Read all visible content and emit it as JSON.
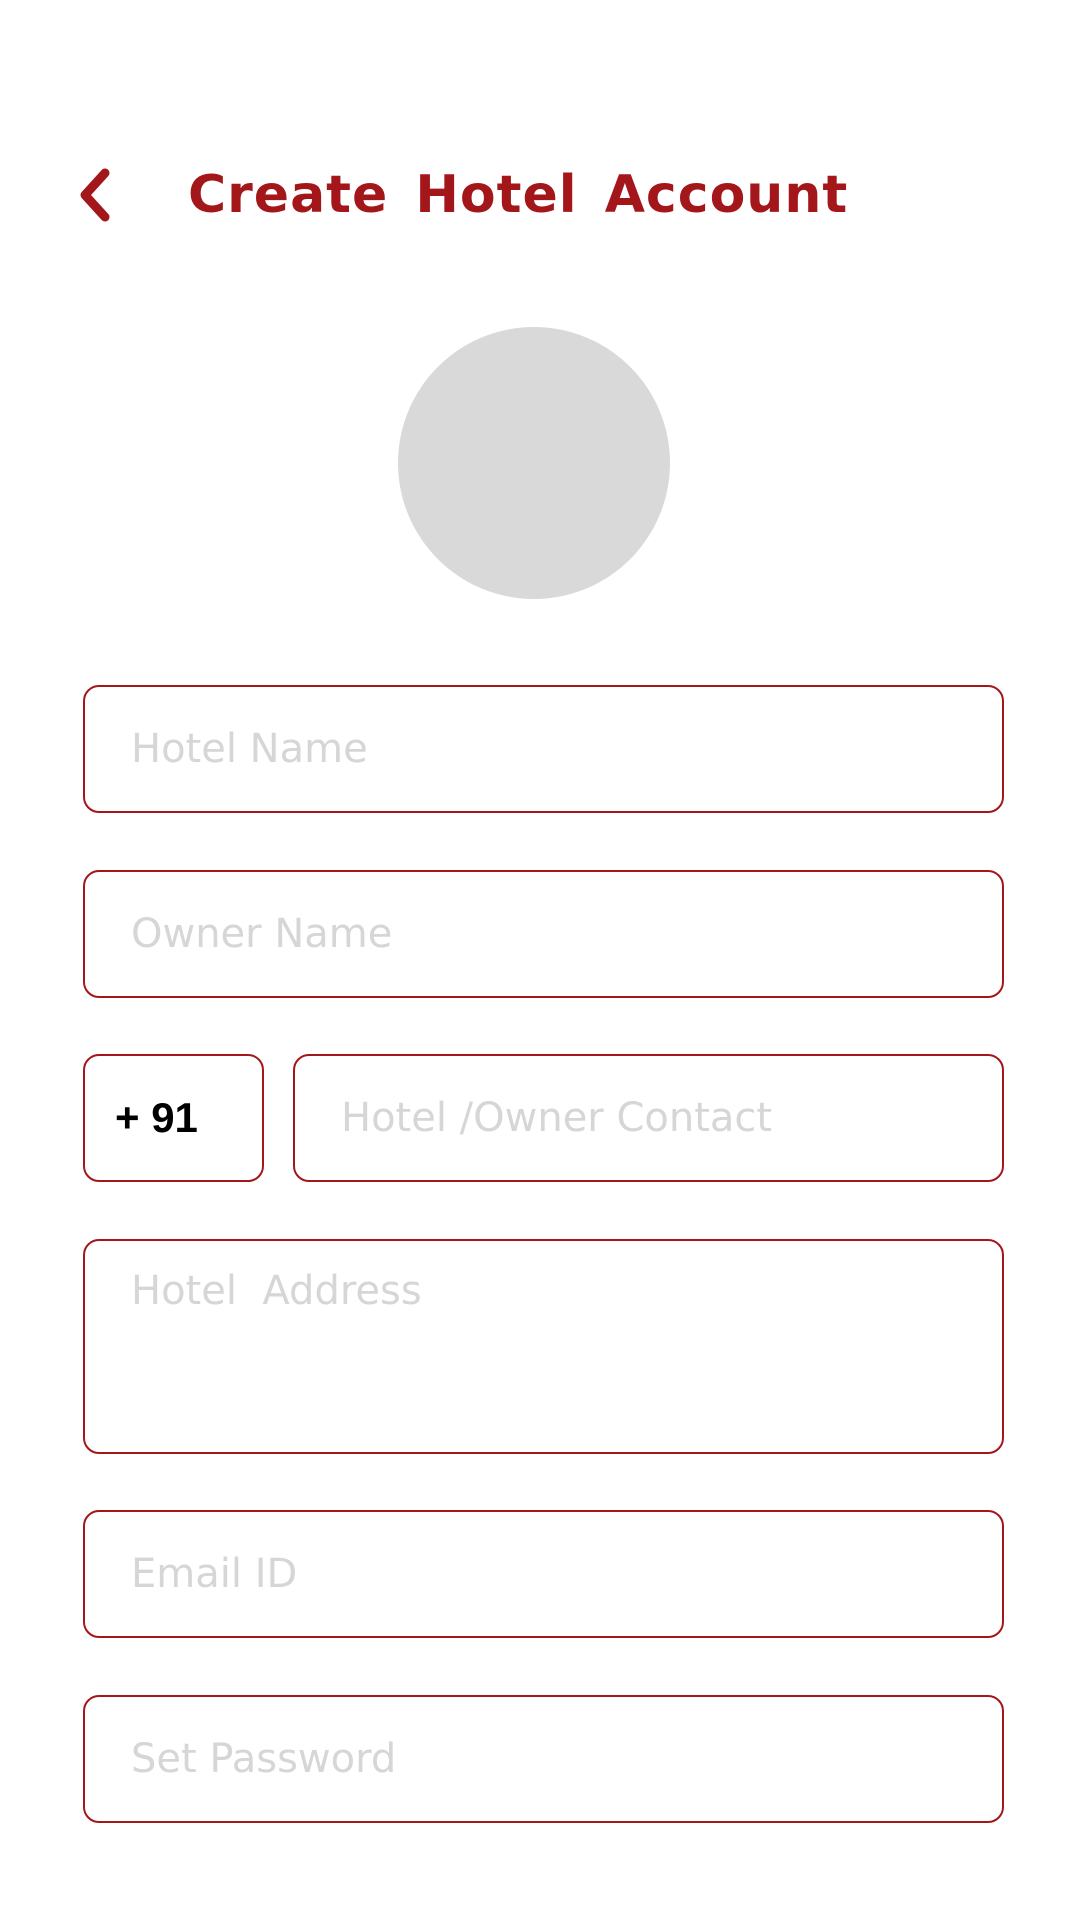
{
  "header": {
    "back_icon": "chevron-left-icon",
    "title": "Create Hotel Account"
  },
  "colors": {
    "accent": "#a3171b",
    "placeholder": "#d6d6d6",
    "avatar_placeholder": "#d9d9d9"
  },
  "form": {
    "hotel_name": {
      "placeholder": "Hotel Name",
      "value": ""
    },
    "owner_name": {
      "placeholder": "Owner Name",
      "value": ""
    },
    "country_code": {
      "value": "+ 91"
    },
    "contact": {
      "placeholder": "Hotel /Owner Contact",
      "value": ""
    },
    "address": {
      "placeholder": "Hotel  Address",
      "value": ""
    },
    "email": {
      "placeholder": "Email ID",
      "value": ""
    },
    "password": {
      "placeholder": "Set Password",
      "value": ""
    }
  }
}
